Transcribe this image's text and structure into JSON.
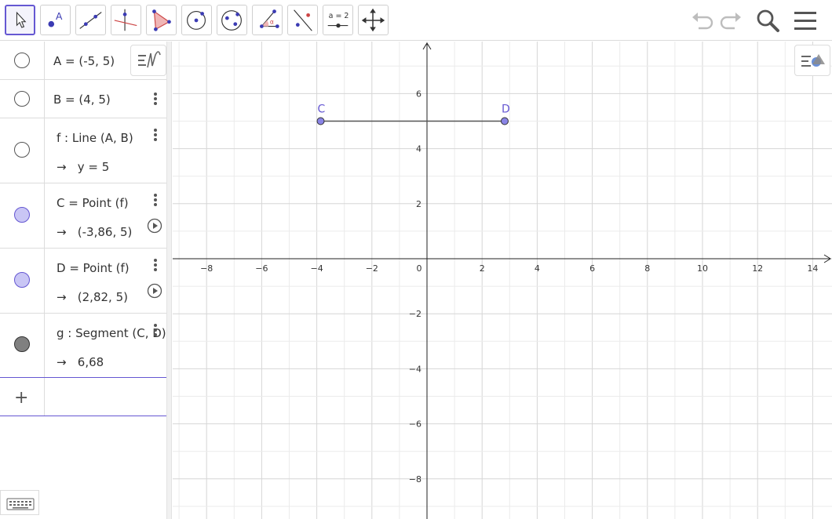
{
  "toolbar": {
    "tools": [
      {
        "name": "move-tool",
        "icon": "cursor-arrow-icon",
        "active": true
      },
      {
        "name": "point-tool",
        "icon": "point-A-icon",
        "label": "A"
      },
      {
        "name": "line-tool",
        "icon": "line-through-points-icon"
      },
      {
        "name": "perpendicular-line-tool",
        "icon": "perpendicular-icon"
      },
      {
        "name": "polygon-tool",
        "icon": "polygon-icon"
      },
      {
        "name": "circle-center-point-tool",
        "icon": "circle-center-icon"
      },
      {
        "name": "ellipse-tool",
        "icon": "conic-icon"
      },
      {
        "name": "angle-tool",
        "icon": "angle-icon",
        "label": "α"
      },
      {
        "name": "reflect-tool",
        "icon": "reflect-icon"
      },
      {
        "name": "slider-tool",
        "icon": "slider-icon",
        "label": "a = 2"
      },
      {
        "name": "move-graphics-view-tool",
        "icon": "move-view-icon"
      }
    ],
    "undo_icon": "undo-icon",
    "redo_icon": "redo-icon",
    "search_icon": "search-icon",
    "menu_icon": "hamburger-menu-icon"
  },
  "algebra": {
    "rows": [
      {
        "def": "A = (-5, 5)",
        "color": "#ffffff"
      },
      {
        "def": "B = (4, 5)",
        "color": "#ffffff"
      },
      {
        "def": "f : Line (A, B)",
        "value": "y = 5",
        "color": "#ffffff"
      },
      {
        "def": "C = Point (f)",
        "value": "(-3,86, 5)",
        "color": "#c9c6f5"
      },
      {
        "def": "D = Point (f)",
        "value": "(2,82, 5)",
        "color": "#c9c6f5"
      },
      {
        "def": "g : Segment (C, D)",
        "value": "6,68",
        "color": "#808080"
      }
    ],
    "input_plus": "+",
    "arrow": "→"
  },
  "graphics": {
    "x_ticks": [
      "-8",
      "-6",
      "-4",
      "-2",
      "0",
      "2",
      "4",
      "6",
      "8",
      "10",
      "12",
      "14"
    ],
    "y_ticks": [
      "6",
      "4",
      "2",
      "-2",
      "-4",
      "-6",
      "-8"
    ],
    "points": [
      {
        "label": "C",
        "x": -3.86,
        "y": 5
      },
      {
        "label": "D",
        "x": 2.82,
        "y": 5
      }
    ],
    "segment": {
      "from": "C",
      "to": "D"
    },
    "point_color": "#6557d2",
    "point_fill": "#8a84e6"
  }
}
